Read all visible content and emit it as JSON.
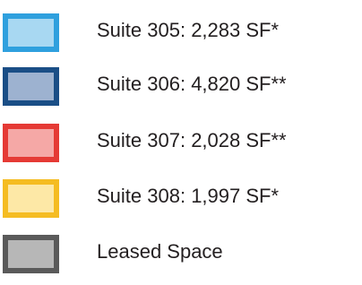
{
  "legend": {
    "items": [
      {
        "label": "Suite 305: 2,283 SF*",
        "fill": "#a8d8f2",
        "border": "#2fa0de"
      },
      {
        "label": "Suite 306: 4,820 SF**",
        "fill": "#9db2d0",
        "border": "#1a4e86"
      },
      {
        "label": "Suite 307: 2,028 SF**",
        "fill": "#f5a8a6",
        "border": "#e53a35"
      },
      {
        "label": "Suite 308: 1,997 SF*",
        "fill": "#fde8a6",
        "border": "#f5bc22"
      },
      {
        "label": "Leased Space",
        "fill": "#b7b7b7",
        "border": "#5a5a5a"
      }
    ]
  }
}
